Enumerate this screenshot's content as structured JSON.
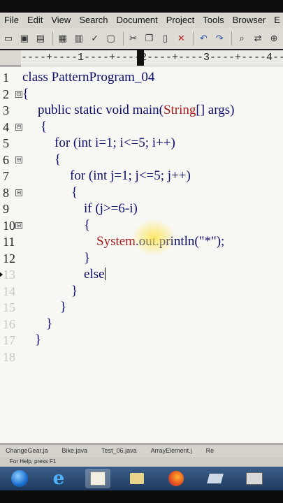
{
  "menu": [
    "File",
    "Edit",
    "View",
    "Search",
    "Document",
    "Project",
    "Tools",
    "Browser",
    "E"
  ],
  "ruler_text": "----+----1----+----2----+----3----+----4----+",
  "lines": [
    {
      "n": "1",
      "fold": "",
      "indent": 32,
      "parts": [
        {
          "t": "class PatternProgram_04"
        }
      ]
    },
    {
      "n": "2",
      "fold": "⊟",
      "indent": 32,
      "parts": [
        {
          "t": "{"
        }
      ]
    },
    {
      "n": "3",
      "fold": "",
      "indent": 54,
      "parts": [
        {
          "t": "public static void main("
        },
        {
          "t": "String",
          "c": "red"
        },
        {
          "t": "[] args)"
        }
      ]
    },
    {
      "n": "4",
      "fold": "⊟",
      "indent": 58,
      "parts": [
        {
          "t": "{"
        }
      ]
    },
    {
      "n": "5",
      "fold": "",
      "indent": 78,
      "parts": [
        {
          "t": "for (int i=1; i<=5; i++)"
        }
      ]
    },
    {
      "n": "6",
      "fold": "⊟",
      "indent": 78,
      "parts": [
        {
          "t": "{"
        }
      ]
    },
    {
      "n": "7",
      "fold": "",
      "indent": 100,
      "parts": [
        {
          "t": "for (int j=1; j<=5; j++)"
        }
      ]
    },
    {
      "n": "8",
      "fold": "⊟",
      "indent": 102,
      "parts": [
        {
          "t": "{"
        }
      ]
    },
    {
      "n": "9",
      "fold": "",
      "indent": 120,
      "parts": [
        {
          "t": "if (j>=6-i)"
        }
      ]
    },
    {
      "n": "10",
      "fold": "⊟",
      "indent": 120,
      "parts": [
        {
          "t": "{"
        }
      ]
    },
    {
      "n": "11",
      "fold": "",
      "indent": 138,
      "parts": [
        {
          "t": "System",
          "c": "red"
        },
        {
          "t": ".out.println(\"*\");"
        }
      ]
    },
    {
      "n": "12",
      "fold": "",
      "indent": 120,
      "parts": [
        {
          "t": "}"
        }
      ]
    },
    {
      "n": "13",
      "fold": "",
      "indent": 120,
      "parts": [
        {
          "t": "else"
        }
      ],
      "caret": true,
      "marker": true
    },
    {
      "n": "14",
      "fold": "",
      "indent": 102,
      "parts": [
        {
          "t": "}"
        }
      ]
    },
    {
      "n": "15",
      "fold": "",
      "indent": 86,
      "parts": [
        {
          "t": "}"
        }
      ]
    },
    {
      "n": "16",
      "fold": "",
      "indent": 66,
      "parts": [
        {
          "t": "}"
        }
      ]
    },
    {
      "n": "17",
      "fold": "",
      "indent": 50,
      "parts": [
        {
          "t": "}"
        }
      ]
    },
    {
      "n": "18",
      "fold": "",
      "indent": 50,
      "parts": []
    }
  ],
  "dim_from": 13,
  "tabs": [
    "ChangeGear.ja",
    "Bike.java",
    "Test_06.java",
    "ArrayElement.j",
    "Re"
  ],
  "status_text": "For Help, press F1",
  "colors": {
    "keyword_text": "#0d0d6b",
    "class_ref": "#a51c1c"
  }
}
